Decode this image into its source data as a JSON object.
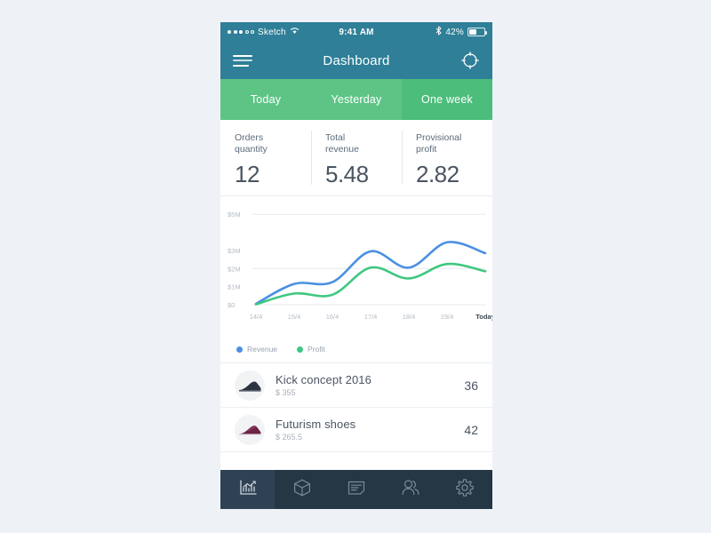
{
  "statusbar": {
    "carrier": "Sketch",
    "signal_icon": "signal-dots-icon",
    "wifi_icon": "wifi-icon",
    "time": "9:41 AM",
    "bluetooth_icon": "bluetooth-icon",
    "battery_percent": "42%",
    "battery_icon": "battery-icon"
  },
  "navbar": {
    "menu_icon": "hamburger-menu-icon",
    "title": "Dashboard",
    "refresh_icon": "refresh-icon"
  },
  "tabs": [
    {
      "label": "Today",
      "active": false
    },
    {
      "label": "Yesterday",
      "active": false
    },
    {
      "label": "One week",
      "active": true
    }
  ],
  "stats": [
    {
      "label": "Orders\nquantity",
      "value": "12"
    },
    {
      "label": "Total\nrevenue",
      "value": "5.48"
    },
    {
      "label": "Provisional\nprofit",
      "value": "2.82"
    }
  ],
  "chart_data": {
    "type": "line",
    "title": "",
    "xlabel": "",
    "ylabel": "",
    "grid": true,
    "legend_position": "bottom-left",
    "y_ticks": [
      "$5M",
      "$3M",
      "$2M",
      "$1M",
      "$0"
    ],
    "y_tick_values": [
      5,
      3,
      2,
      1,
      0
    ],
    "ylim": [
      0,
      5.6
    ],
    "categories": [
      "14/4",
      "15/4",
      "16/4",
      "17/4",
      "18/4",
      "19/4",
      "Today"
    ],
    "series": [
      {
        "name": "Revenue",
        "color": "#4a90e2",
        "values": [
          0.05,
          1.15,
          1.25,
          2.95,
          2.05,
          3.45,
          2.85
        ]
      },
      {
        "name": "Profit",
        "color": "#3fc77f",
        "values": [
          0.02,
          0.62,
          0.55,
          2.05,
          1.45,
          2.25,
          1.85
        ]
      }
    ]
  },
  "products": [
    {
      "name": "Kick concept 2016",
      "price": "$ 355",
      "count": "36",
      "thumb": "black-sneaker-icon"
    },
    {
      "name": "Futurism shoes",
      "price": "$ 265.5",
      "count": "42",
      "thumb": "purple-sneaker-icon"
    }
  ],
  "tabbar": [
    {
      "icon": "analytics-chart-icon",
      "active": true
    },
    {
      "icon": "package-box-icon",
      "active": false
    },
    {
      "icon": "invoice-document-icon",
      "active": false
    },
    {
      "icon": "users-icon",
      "active": false
    },
    {
      "icon": "settings-gear-icon",
      "active": false
    }
  ],
  "colors": {
    "page_background": "#eef2f7",
    "navbar": "#2e7f97",
    "tabs": "#5dc486",
    "tab_active": "#4cbd7b",
    "tabbar": "#253645",
    "tabbar_active": "#2e4254",
    "revenue": "#4a90e2",
    "profit": "#3fc77f"
  }
}
